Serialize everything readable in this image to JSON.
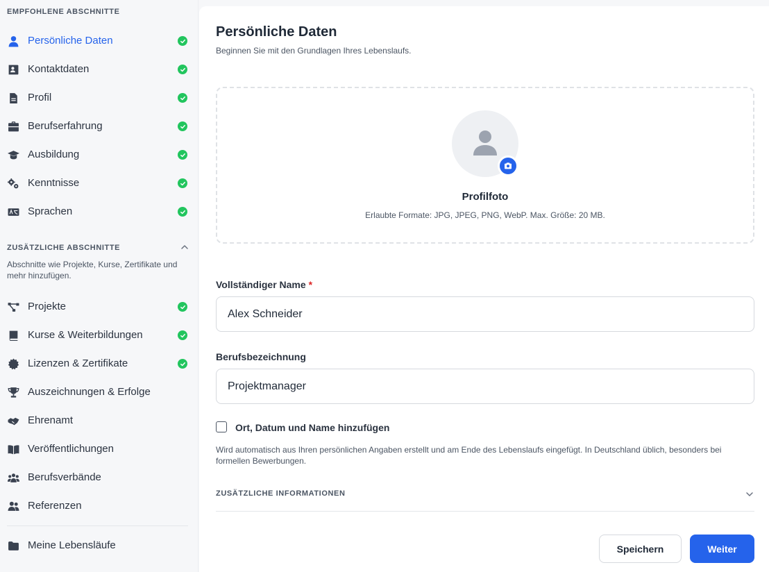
{
  "sidebar": {
    "recommended_heading": "EMPFOHLENE ABSCHNITTE",
    "recommended": [
      {
        "label": "Persönliche Daten",
        "icon": "user-icon",
        "done": true,
        "active": true
      },
      {
        "label": "Kontaktdaten",
        "icon": "contact-card-icon",
        "done": true
      },
      {
        "label": "Profil",
        "icon": "document-icon",
        "done": true
      },
      {
        "label": "Berufserfahrung",
        "icon": "briefcase-icon",
        "done": true
      },
      {
        "label": "Ausbildung",
        "icon": "graduation-cap-icon",
        "done": true
      },
      {
        "label": "Kenntnisse",
        "icon": "gears-icon",
        "done": true
      },
      {
        "label": "Sprachen",
        "icon": "language-icon",
        "done": true
      }
    ],
    "additional_heading": "ZUSÄTZLICHE ABSCHNITTE",
    "additional_description": "Abschnitte wie Projekte, Kurse, Zertifikate und mehr hinzufügen.",
    "additional": [
      {
        "label": "Projekte",
        "icon": "diagram-icon",
        "done": true
      },
      {
        "label": "Kurse & Weiterbildungen",
        "icon": "book-icon",
        "done": true
      },
      {
        "label": "Lizenzen & Zertifikate",
        "icon": "certificate-icon",
        "done": true
      },
      {
        "label": "Auszeichnungen & Erfolge",
        "icon": "trophy-icon",
        "done": false
      },
      {
        "label": "Ehrenamt",
        "icon": "handshake-icon",
        "done": false
      },
      {
        "label": "Veröffentlichungen",
        "icon": "open-book-icon",
        "done": false
      },
      {
        "label": "Berufsverbände",
        "icon": "group-icon",
        "done": false
      },
      {
        "label": "Referenzen",
        "icon": "people-icon",
        "done": false
      }
    ],
    "my_resumes": {
      "label": "Meine Lebensläufe",
      "icon": "folder-icon"
    }
  },
  "main": {
    "title": "Persönliche Daten",
    "subtitle": "Beginnen Sie mit den Grundlagen Ihres Lebenslaufs.",
    "photo": {
      "title": "Profilfoto",
      "hint": "Erlaubte Formate: JPG, JPEG, PNG, WebP. Max. Größe: 20 MB."
    },
    "full_name": {
      "label": "Vollständiger Name",
      "required_mark": "*",
      "value": "Alex Schneider"
    },
    "job_title": {
      "label": "Berufsbezeichnung",
      "value": "Projektmanager"
    },
    "place_date": {
      "label": "Ort, Datum und Name hinzufügen",
      "checked": false,
      "description": "Wird automatisch aus Ihren persönlichen Angaben erstellt und am Ende des Lebenslaufs eingefügt. In Deutschland üblich, besonders bei formellen Bewerbungen."
    },
    "additional_info_label": "ZUSÄTZLICHE INFORMATIONEN",
    "save_label": "Speichern",
    "next_label": "Weiter"
  },
  "colors": {
    "accent": "#2563eb",
    "success": "#22c55e",
    "required": "#dc2626"
  }
}
